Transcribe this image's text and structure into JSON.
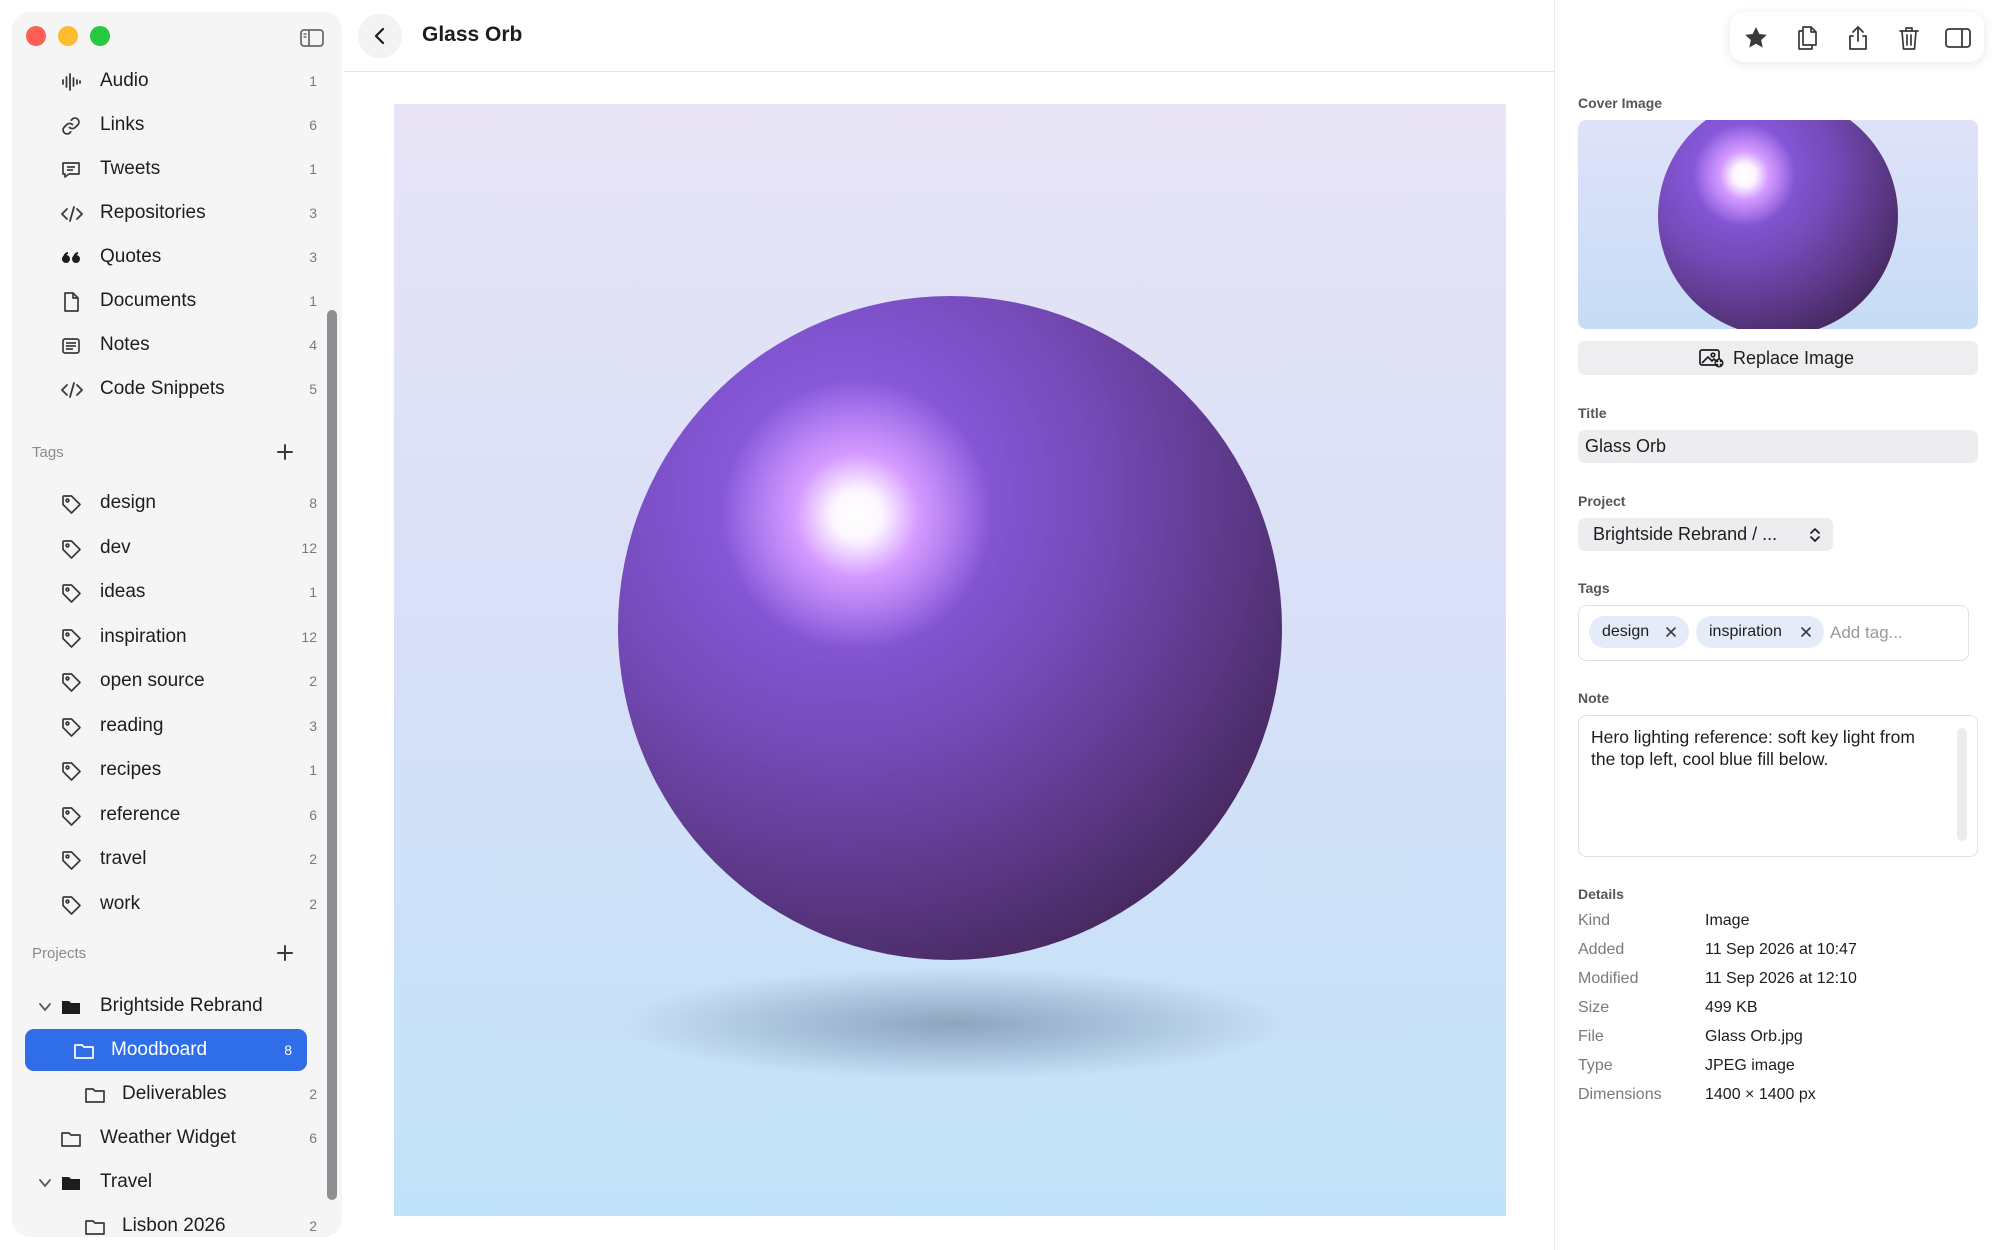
{
  "header": {
    "title": "Glass Orb"
  },
  "sidebar": {
    "types": [
      {
        "label": "Audio",
        "count": "1",
        "icon": "waveform-icon"
      },
      {
        "label": "Links",
        "count": "6",
        "icon": "link-icon"
      },
      {
        "label": "Tweets",
        "count": "1",
        "icon": "speech-bubble-icon"
      },
      {
        "label": "Repositories",
        "count": "3",
        "icon": "code-icon"
      },
      {
        "label": "Quotes",
        "count": "3",
        "icon": "quote-icon"
      },
      {
        "label": "Documents",
        "count": "1",
        "icon": "document-icon"
      },
      {
        "label": "Notes",
        "count": "4",
        "icon": "notes-icon"
      },
      {
        "label": "Code Snippets",
        "count": "5",
        "icon": "code-icon"
      }
    ],
    "tags_heading": "Tags",
    "tags": [
      {
        "label": "design",
        "count": "8"
      },
      {
        "label": "dev",
        "count": "12"
      },
      {
        "label": "ideas",
        "count": "1"
      },
      {
        "label": "inspiration",
        "count": "12"
      },
      {
        "label": "open source",
        "count": "2"
      },
      {
        "label": "reading",
        "count": "3"
      },
      {
        "label": "recipes",
        "count": "1"
      },
      {
        "label": "reference",
        "count": "6"
      },
      {
        "label": "travel",
        "count": "2"
      },
      {
        "label": "work",
        "count": "2"
      }
    ],
    "projects_heading": "Projects",
    "projects": [
      {
        "label": "Brightside Rebrand",
        "count": ""
      },
      {
        "label": "Moodboard",
        "count": "8"
      },
      {
        "label": "Deliverables",
        "count": "2"
      },
      {
        "label": "Weather Widget",
        "count": "6"
      },
      {
        "label": "Travel",
        "count": ""
      },
      {
        "label": "Lisbon 2026",
        "count": "2"
      }
    ]
  },
  "inspector": {
    "cover_label": "Cover Image",
    "replace_label": "Replace Image",
    "title_label": "Title",
    "title_value": "Glass Orb",
    "project_label": "Project",
    "project_value": "Brightside Rebrand / ...",
    "tags_label": "Tags",
    "tags": [
      "design",
      "inspiration"
    ],
    "tag_placeholder": "Add tag...",
    "note_label": "Note",
    "note_value": "Hero lighting reference: soft key light from the top left, cool blue fill below.",
    "details_label": "Details",
    "details": [
      {
        "key": "Kind",
        "value": "Image"
      },
      {
        "key": "Added",
        "value": "11 Sep 2026 at 10:47"
      },
      {
        "key": "Modified",
        "value": "11 Sep 2026 at 12:10"
      },
      {
        "key": "Size",
        "value": "499 KB"
      },
      {
        "key": "File",
        "value": "Glass Orb.jpg"
      },
      {
        "key": "Type",
        "value": "JPEG image"
      },
      {
        "key": "Dimensions",
        "value": "1400 × 1400 px"
      }
    ]
  },
  "toolbar": {
    "icons": [
      "star-icon",
      "copy-icon",
      "share-icon",
      "trash-icon",
      "inspector-toggle-icon"
    ]
  },
  "colors": {
    "accent": "#2f6ee8",
    "sidebar_bg": "#f5f5f6",
    "orb_purple": "#754ab8",
    "hero_bg_top": "#e8e4f6",
    "hero_bg_bottom": "#c0e2f8"
  }
}
